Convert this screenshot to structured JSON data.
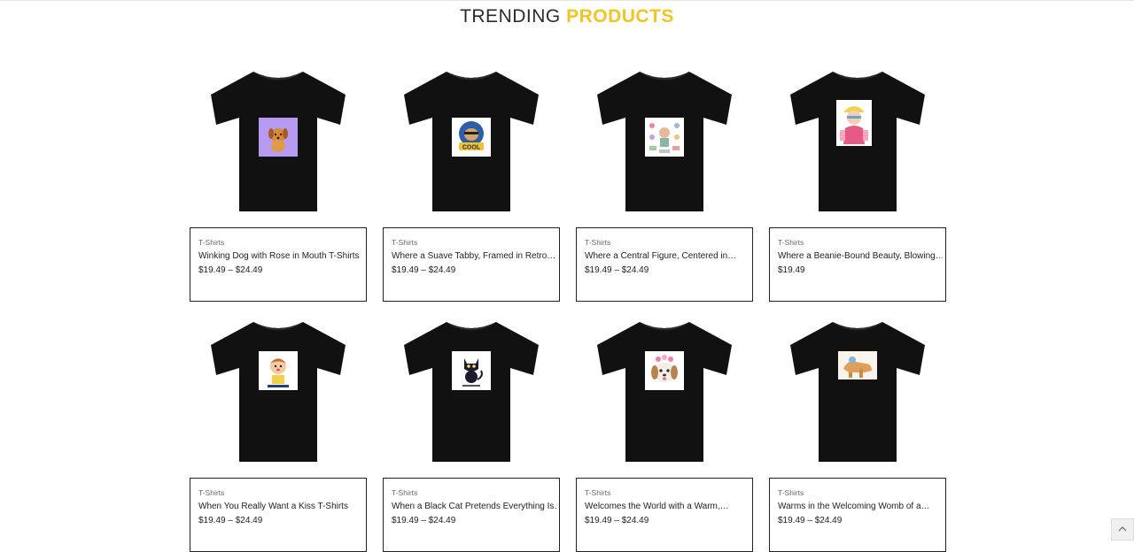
{
  "section": {
    "title_part1": "TRENDING",
    "title_part2": "PRODUCTS"
  },
  "colors": {
    "accent": "#f4c326",
    "shirt": "#111111",
    "border": "#222222"
  },
  "products": [
    {
      "category": "T-Shirts",
      "name": "Winking Dog with Rose in Mouth T-Shirts",
      "price": "$19.49 – $24.49",
      "print_icon": "dog-icon"
    },
    {
      "category": "T-Shirts",
      "name": "Where a Suave Tabby, Framed in Retro…",
      "price": "$19.49 – $24.49",
      "print_icon": "cool-cat-icon"
    },
    {
      "category": "T-Shirts",
      "name": "Where a Central Figure, Centered in…",
      "price": "$19.49 – $24.49",
      "print_icon": "collage-icon"
    },
    {
      "category": "T-Shirts",
      "name": "Where a Beanie-Bound Beauty, Blowing…",
      "price": "$19.49",
      "print_icon": "beanie-girl-icon"
    },
    {
      "category": "T-Shirts",
      "name": "When You Really Want a Kiss T-Shirts",
      "price": "$19.49 – $24.49",
      "print_icon": "kiss-character-icon"
    },
    {
      "category": "T-Shirts",
      "name": "When a Black Cat Pretends Everything Is…",
      "price": "$19.49 – $24.49",
      "print_icon": "black-cat-icon"
    },
    {
      "category": "T-Shirts",
      "name": "Welcomes the World with a Warm,…",
      "price": "$19.49 – $24.49",
      "print_icon": "puppy-flower-icon"
    },
    {
      "category": "T-Shirts",
      "name": "Warms in the Welcoming Womb of a…",
      "price": "$19.49 – $24.49",
      "print_icon": "cozy-scene-icon"
    }
  ]
}
